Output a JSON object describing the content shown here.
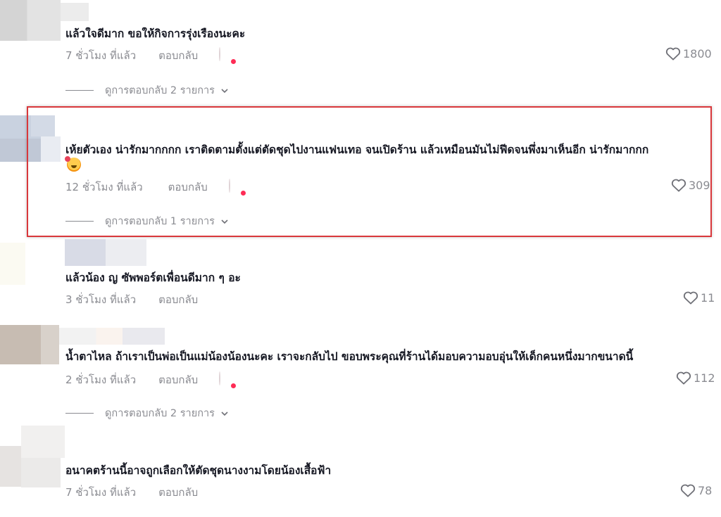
{
  "colors": {
    "text": "#161823",
    "muted": "#8a8b91",
    "highlight_border": "#d9373b",
    "badge": "#fe2c55"
  },
  "icons": {
    "like": "heart-outline-icon",
    "expand": "chevron-down-icon",
    "creator_liked": "creator-avatar-heart-badge-icon",
    "emoji": "smiling-face-with-hearts-emoji"
  },
  "comments": [
    {
      "text": "แล้วใจดีมาก ขอให้กิจการรุ่งเรืองนะคะ",
      "time": "7 ชั่วโมง ที่แล้ว",
      "reply_label": "ตอบกลับ",
      "likes": "1800",
      "creator_liked": true,
      "view_replies": "ดูการตอบกลับ 2 รายการ"
    },
    {
      "text": "เห้ยตัวเอง น่ารักมากกกก เราติดตามตั้งแต่ตัดชุดไปงานแฟนเทอ จนเปิดร้าน แล้วเหมือนมันไม่ฟีดจนพึ่งมาเห็นอีก น่ารักมากกก",
      "time": "12 ชั่วโมง ที่แล้ว",
      "reply_label": "ตอบกลับ",
      "likes": "309",
      "creator_liked": true,
      "view_replies": "ดูการตอบกลับ 1 รายการ",
      "highlighted": true
    },
    {
      "text": "แล้วน้อง ญ ซัพพอร์ตเพื่อนดีมาก ๆ อะ",
      "time": "3 ชั่วโมง ที่แล้ว",
      "reply_label": "ตอบกลับ",
      "likes": "11",
      "creator_liked": false
    },
    {
      "text": "น้ำตาไหล ถ้าเราเป็นพ่อเป็นแม่น้องน้องนะคะ เราจะกลับไป ขอบพระคุณที่ร้านได้มอบความอบอุ่นให้เด็กคนหนึ่งมากขนาดนี้",
      "time": "2 ชั่วโมง ที่แล้ว",
      "reply_label": "ตอบกลับ",
      "likes": "112",
      "creator_liked": true,
      "view_replies": "ดูการตอบกลับ 2 รายการ"
    },
    {
      "text": "อนาคตร้านนี้อาจถูกเลือกให้ตัดชุดนางงามโดยน้องเสื้อฟ้า",
      "time": "7 ชั่วโมง ที่แล้ว",
      "reply_label": "ตอบกลับ",
      "likes": "78",
      "creator_liked": false
    }
  ]
}
